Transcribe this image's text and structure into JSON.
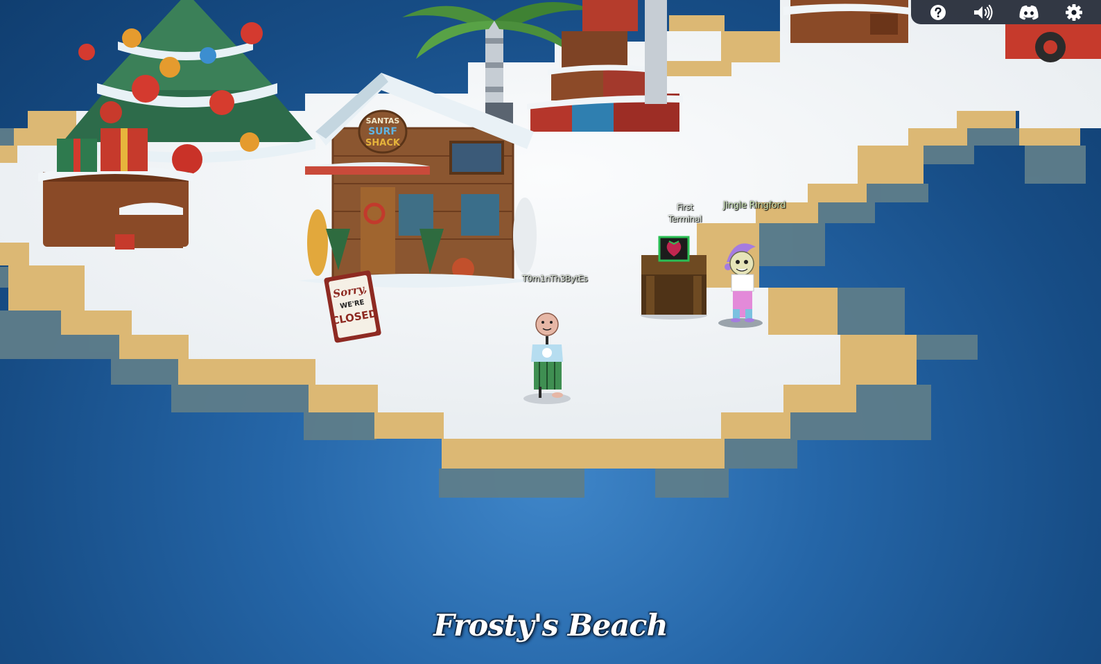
{
  "location": {
    "title": "Frosty's Beach"
  },
  "player": {
    "name": "T0m1nTh3BytEs"
  },
  "terminal": {
    "name": "First\nTerminal"
  },
  "npc": {
    "name": "Jingle Ringford"
  },
  "shack": {
    "sign_line1": "SANTAS",
    "sign_line2": "SURF",
    "sign_line3": "SHACK"
  },
  "closed_sign": {
    "line1": "Sorry,",
    "line2": "WE'RE",
    "line3": "CLOSED"
  },
  "toolbar": {
    "buttons": [
      {
        "icon": "help-icon"
      },
      {
        "icon": "volume-icon"
      },
      {
        "icon": "discord-icon"
      },
      {
        "icon": "gear-icon"
      }
    ]
  },
  "colors": {
    "water": "#1c5a98",
    "sand": "#dcb874",
    "sand_shadow": "#5e7d8a",
    "snow": "#f3f5f7",
    "accent_green": "#cde6b8"
  }
}
